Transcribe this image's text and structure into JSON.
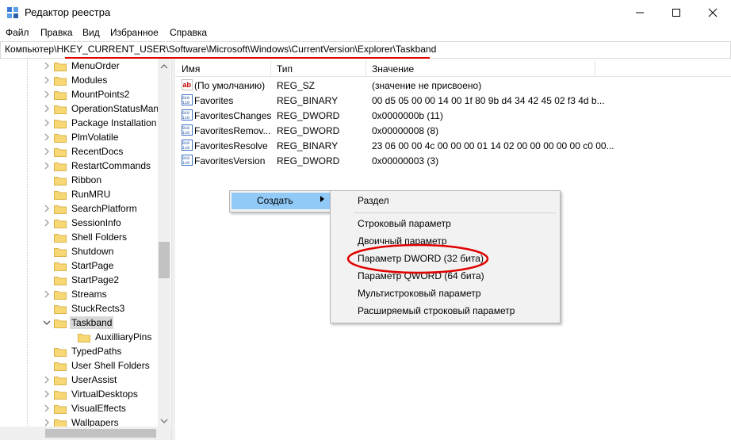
{
  "window": {
    "title": "Редактор реестра"
  },
  "menu": [
    "Файл",
    "Правка",
    "Вид",
    "Избранное",
    "Справка"
  ],
  "address": {
    "path": "Компьютер\\HKEY_CURRENT_USER\\Software\\Microsoft\\Windows\\CurrentVersion\\Explorer\\Taskband"
  },
  "tree": {
    "items": [
      {
        "label": "MenuOrder",
        "expandable": true
      },
      {
        "label": "Modules",
        "expandable": true
      },
      {
        "label": "MountPoints2",
        "expandable": true
      },
      {
        "label": "OperationStatusMan",
        "expandable": true
      },
      {
        "label": "Package Installation",
        "expandable": true
      },
      {
        "label": "PlmVolatile",
        "expandable": true
      },
      {
        "label": "RecentDocs",
        "expandable": true
      },
      {
        "label": "RestartCommands",
        "expandable": true
      },
      {
        "label": "Ribbon",
        "expandable": false
      },
      {
        "label": "RunMRU",
        "expandable": false
      },
      {
        "label": "SearchPlatform",
        "expandable": true
      },
      {
        "label": "SessionInfo",
        "expandable": true
      },
      {
        "label": "Shell Folders",
        "expandable": false
      },
      {
        "label": "Shutdown",
        "expandable": false
      },
      {
        "label": "StartPage",
        "expandable": false
      },
      {
        "label": "StartPage2",
        "expandable": false
      },
      {
        "label": "Streams",
        "expandable": true
      },
      {
        "label": "StuckRects3",
        "expandable": false
      },
      {
        "label": "Taskband",
        "expanded": true,
        "selected": true
      },
      {
        "label": "AuxilliaryPins",
        "child": true
      },
      {
        "label": "TypedPaths",
        "expandable": false
      },
      {
        "label": "User Shell Folders",
        "expandable": false
      },
      {
        "label": "UserAssist",
        "expandable": true
      },
      {
        "label": "VirtualDesktops",
        "expandable": true
      },
      {
        "label": "VisualEffects",
        "expandable": true
      },
      {
        "label": "Wallpapers",
        "expandable": true
      }
    ]
  },
  "list": {
    "headers": {
      "name": "Имя",
      "type": "Тип",
      "value": "Значение"
    },
    "rows": [
      {
        "icon": "string-value-icon",
        "name": "(По умолчанию)",
        "type": "REG_SZ",
        "value": "(значение не присвоено)"
      },
      {
        "icon": "binary-value-icon",
        "name": "Favorites",
        "type": "REG_BINARY",
        "value": "00 d5 05 00 00 14 00 1f 80 9b d4 34 42 45 02 f3 4d b..."
      },
      {
        "icon": "binary-value-icon",
        "name": "FavoritesChanges",
        "type": "REG_DWORD",
        "value": "0x0000000b (11)"
      },
      {
        "icon": "binary-value-icon",
        "name": "FavoritesRemov...",
        "type": "REG_DWORD",
        "value": "0x00000008 (8)"
      },
      {
        "icon": "binary-value-icon",
        "name": "FavoritesResolve",
        "type": "REG_BINARY",
        "value": "23 06 00 00 4c 00 00 00 01 14 02 00 00 00 00 00 c0 00..."
      },
      {
        "icon": "binary-value-icon",
        "name": "FavoritesVersion",
        "type": "REG_DWORD",
        "value": "0x00000003 (3)"
      }
    ]
  },
  "context_menu": {
    "create_label": "Создать"
  },
  "submenu": {
    "items": [
      "Раздел",
      "Строковый параметр",
      "Двоичный параметр",
      "Параметр DWORD (32 бита)",
      "Параметр QWORD (64 бита)",
      "Мультистроковый параметр",
      "Расширяемый строковый параметр"
    ]
  },
  "colors": {
    "highlight": "#91c9f7",
    "annotation_red": "#e00000",
    "folder": "#f8d775",
    "selection": "#d9d9d9"
  }
}
